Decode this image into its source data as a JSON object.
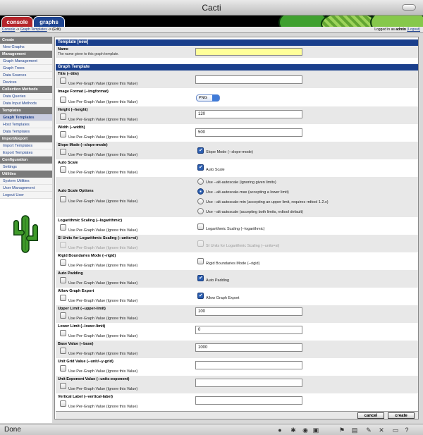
{
  "window": {
    "title": "Cacti"
  },
  "tabs": {
    "console": "console",
    "graphs": "graphs"
  },
  "breadcrumb": {
    "console": "Console",
    "templates": "Graph Templates",
    "current": "-> (Edit)",
    "sep": "->"
  },
  "login": {
    "prefix": "Logged in as",
    "user": "admin",
    "logout": "(Logout)"
  },
  "sidebar": {
    "sections": [
      {
        "title": "Create",
        "items": [
          "New Graphs"
        ]
      },
      {
        "title": "Management",
        "items": [
          "Graph Management",
          "Graph Trees",
          "Data Sources",
          "Devices"
        ]
      },
      {
        "title": "Collection Methods",
        "items": [
          "Data Queries",
          "Data Input Methods"
        ]
      },
      {
        "title": "Templates",
        "items": [
          "Graph Templates",
          "Host Templates",
          "Data Templates"
        ]
      },
      {
        "title": "Import/Export",
        "items": [
          "Import Templates",
          "Export Templates"
        ]
      },
      {
        "title": "Configuration",
        "items": [
          "Settings"
        ]
      },
      {
        "title": "Utilities",
        "items": [
          "System Utilities",
          "User Management",
          "Logout User"
        ]
      }
    ],
    "active": "Graph Templates"
  },
  "template_section": {
    "header": "Template [new]",
    "name_label": "Name",
    "name_desc": "The name given to this graph template.",
    "name_value": ""
  },
  "graph_section": {
    "header": "Graph Template"
  },
  "per_graph_text": "Use Per-Graph Value (Ignore this Value)",
  "fields": {
    "title": {
      "label": "Title (--title)",
      "value": ""
    },
    "format": {
      "label": "Image Format (--imgformat)",
      "value": "PNG"
    },
    "height": {
      "label": "Height (--height)",
      "value": "120"
    },
    "width": {
      "label": "Width (--width)",
      "value": "500"
    },
    "slope": {
      "label": "Slope Mode (--slope-mode)",
      "cb_label": "Slope Mode (--slope-mode)"
    },
    "autoscale": {
      "label": "Auto Scale",
      "cb_label": "Auto Scale"
    },
    "autoscale_opts": {
      "label": "Auto Scale Options",
      "options": [
        "Use --alt-autoscale (ignoring given limits)",
        "Use --alt-autoscale-max (accepting a lower limit)",
        "Use --alt-autoscale-min (accepting an upper limit, requires rrdtool 1.2.x)",
        "Use --alt-autoscale (accepting both limits, rrdtool default)"
      ],
      "selected": 1
    },
    "log": {
      "label": "Logarithmic Scaling (--logarithmic)",
      "cb_label": "Logarithmic Scaling (--logarithmic)"
    },
    "si": {
      "label": "SI Units for Logarithmic Scaling (--units=si)",
      "cb_label": "SI Units for Logarithmic Scaling (--units=si)"
    },
    "rigid": {
      "label": "Rigid Boundaries Mode (--rigid)",
      "cb_label": "Rigid Boundaries Mode (--rigid)"
    },
    "padding": {
      "label": "Auto Padding",
      "cb_label": "Auto Padding"
    },
    "export": {
      "label": "Allow Graph Export",
      "cb_label": "Allow Graph Export"
    },
    "upper": {
      "label": "Upper Limit (--upper-limit)",
      "value": "100"
    },
    "lower": {
      "label": "Lower Limit (--lower-limit)",
      "value": "0"
    },
    "base": {
      "label": "Base Value (--base)",
      "value": "1000"
    },
    "ygrid": {
      "label": "Unit Grid Value (--unit/--y-grid)",
      "value": ""
    },
    "exponent": {
      "label": "Unit Exponent Value (--units-exponent)",
      "value": ""
    },
    "vlabel": {
      "label": "Vertical Label (--vertical-label)",
      "value": ""
    }
  },
  "buttons": {
    "cancel": "cancel",
    "create": "create"
  },
  "status": {
    "text": "Done"
  }
}
